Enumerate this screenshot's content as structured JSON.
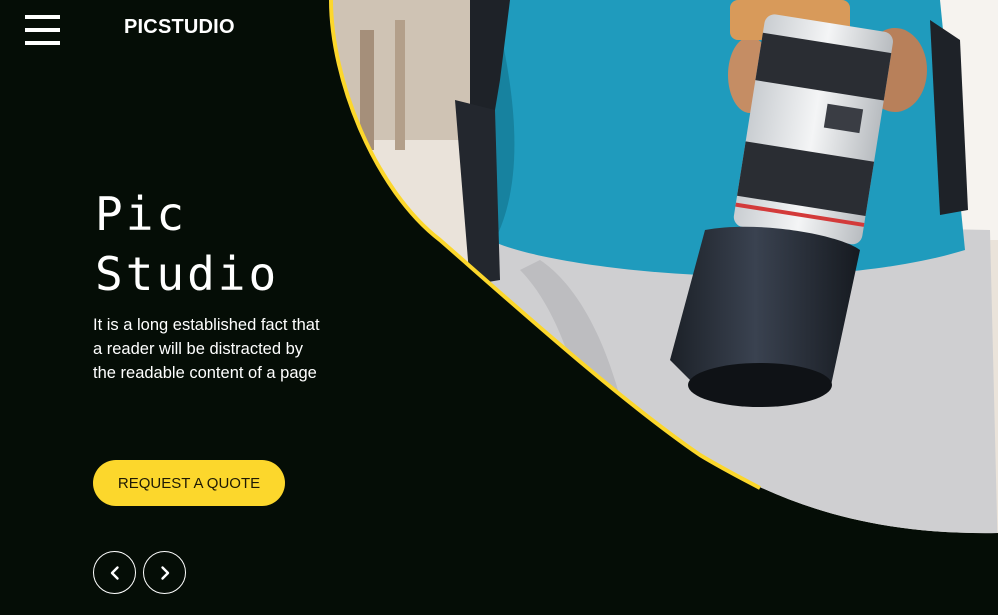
{
  "header": {
    "brand": "PICSTUDIO",
    "menu_icon": "hamburger-menu-icon"
  },
  "hero": {
    "title_line1": "Pic",
    "title_line2": "Studio",
    "description": "It is a long established fact that a reader will be distracted by the readable content of a page",
    "cta_label": "REQUEST A QUOTE",
    "prev_icon": "chevron-left-icon",
    "next_icon": "chevron-right-icon"
  },
  "colors": {
    "background": "#050d06",
    "accent": "#fcd72c",
    "text": "#ffffff"
  }
}
